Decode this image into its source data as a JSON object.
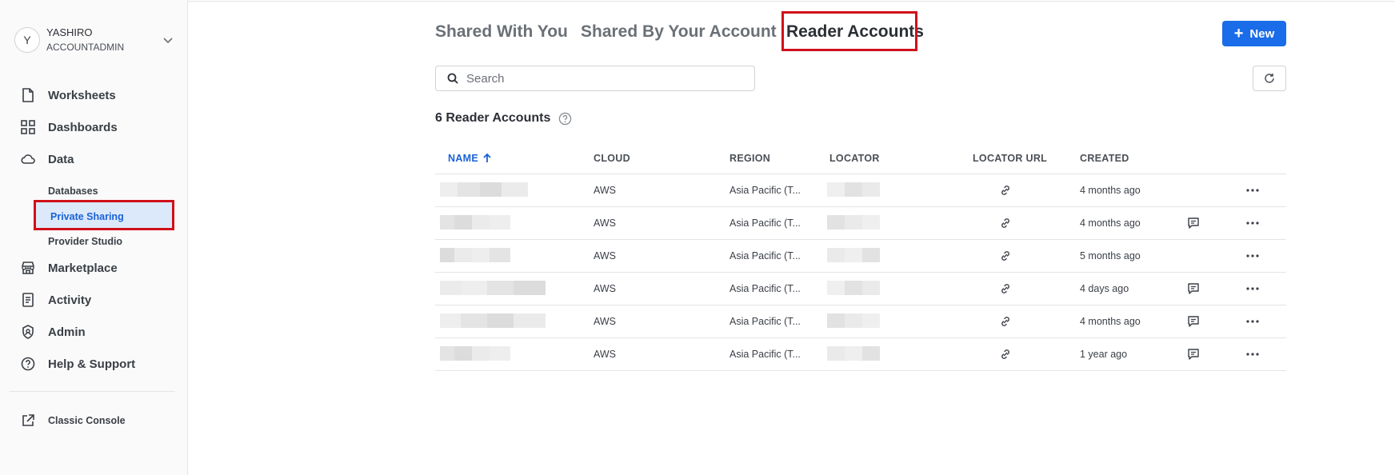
{
  "user": {
    "initial": "Y",
    "name": "YASHIRO",
    "role": "ACCOUNTADMIN"
  },
  "nav": {
    "worksheets": "Worksheets",
    "dashboards": "Dashboards",
    "data": "Data",
    "databases": "Databases",
    "private_sharing": "Private Sharing",
    "provider_studio": "Provider Studio",
    "marketplace": "Marketplace",
    "activity": "Activity",
    "admin": "Admin",
    "help": "Help & Support",
    "classic_console": "Classic Console"
  },
  "tabs": {
    "shared_with_you": "Shared With You",
    "shared_by_account": "Shared By Your Account",
    "reader_accounts": "Reader Accounts"
  },
  "toolbar": {
    "new_label": "New",
    "search_placeholder": "Search"
  },
  "summary": {
    "count_label": "6 Reader Accounts"
  },
  "table": {
    "headers": {
      "name": "NAME",
      "cloud": "CLOUD",
      "region": "REGION",
      "locator": "LOCATOR",
      "locator_url": "LOCATOR URL",
      "created": "CREATED"
    },
    "rows": [
      {
        "cloud": "AWS",
        "region": "Asia Pacific (T...",
        "created": "4 months ago",
        "comment": false
      },
      {
        "cloud": "AWS",
        "region": "Asia Pacific (T...",
        "created": "4 months ago",
        "comment": true
      },
      {
        "cloud": "AWS",
        "region": "Asia Pacific (T...",
        "created": "5 months ago",
        "comment": false
      },
      {
        "cloud": "AWS",
        "region": "Asia Pacific (T...",
        "created": "4 days ago",
        "comment": true
      },
      {
        "cloud": "AWS",
        "region": "Asia Pacific (T...",
        "created": "4 months ago",
        "comment": true
      },
      {
        "cloud": "AWS",
        "region": "Asia Pacific (T...",
        "created": "1 year ago",
        "comment": true
      }
    ]
  },
  "colors": {
    "accent": "#1a6ce8",
    "highlight_box": "#d0101a",
    "active_bg": "#dce9fb"
  }
}
